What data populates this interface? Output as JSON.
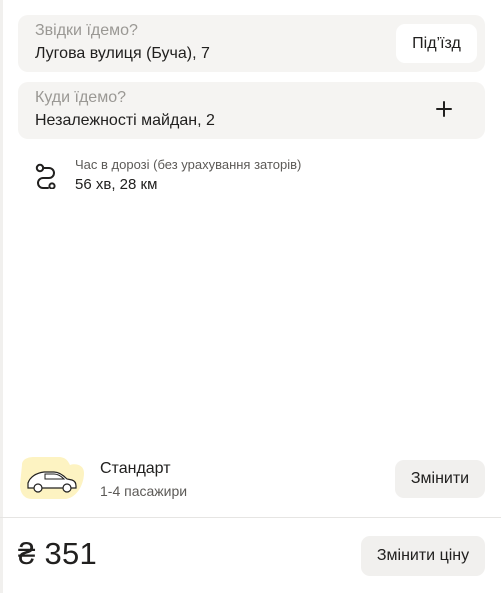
{
  "from": {
    "label": "Звідки їдемо?",
    "value": "Лугова вулиця (Буча), 7",
    "entrance_button": "Під’їзд"
  },
  "to": {
    "label": "Куди їдемо?",
    "value": "Незалежності майдан, 2",
    "add_icon": "plus-icon"
  },
  "route": {
    "icon": "route-icon",
    "caption": "Час в дорозі (без урахування заторів)",
    "value": "56 хв, 28 км"
  },
  "tariff": {
    "icon": "car-icon",
    "name": "Стандарт",
    "description": "1-4 пасажири",
    "change_button": "Змінити"
  },
  "price": {
    "value": "₴ 351",
    "change_button": "Змінити ціну"
  },
  "colors": {
    "field_bg": "#f5f4f2",
    "button_bg": "#f1f0ee",
    "accent_yellow": "#fce000",
    "car_blob": "#fdf3c2"
  }
}
